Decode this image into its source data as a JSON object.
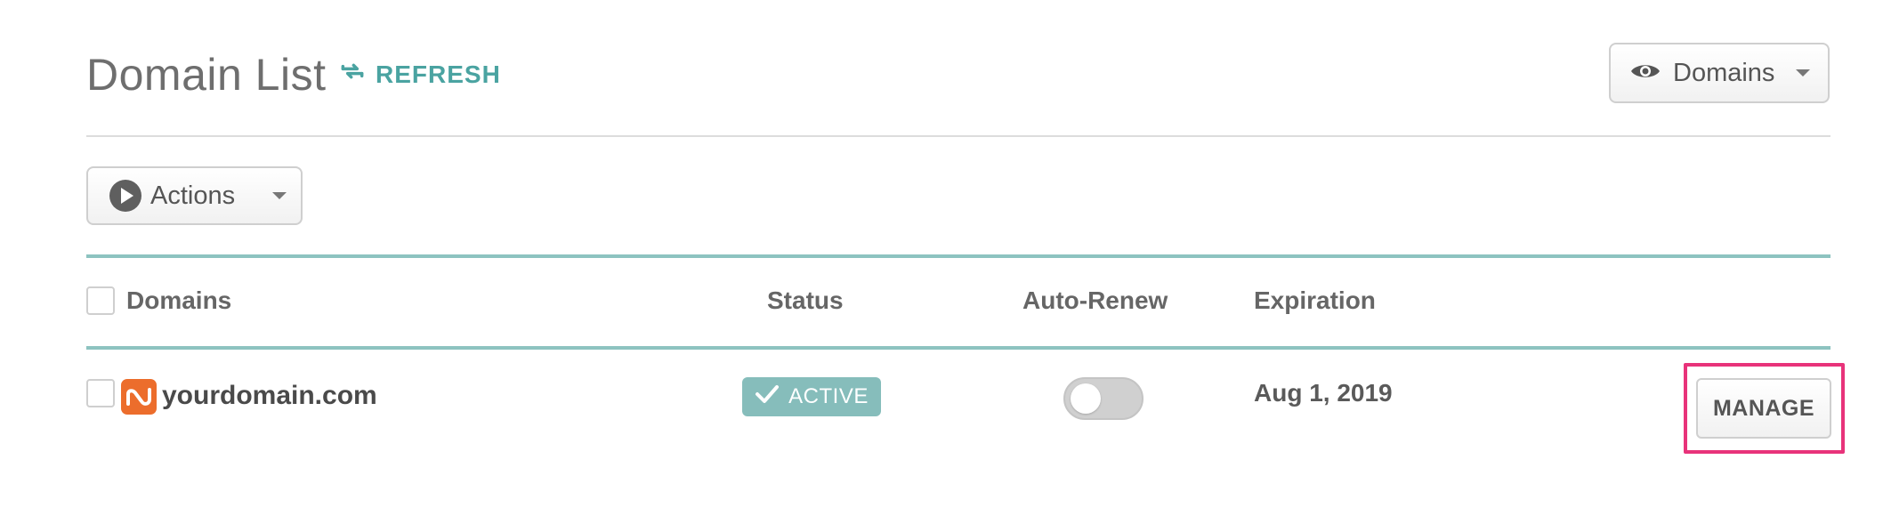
{
  "header": {
    "title": "Domain List",
    "refresh_label": "REFRESH"
  },
  "view_dropdown": {
    "label": "Domains",
    "icon": "eye-icon"
  },
  "actions_dropdown": {
    "label": "Actions",
    "icon": "play-circle-icon"
  },
  "table": {
    "columns": [
      "Domains",
      "Status",
      "Auto-Renew",
      "Expiration"
    ],
    "rows": [
      {
        "domain": "yourdomain.com",
        "status": "ACTIVE",
        "auto_renew": false,
        "expiration": "Aug 1, 2019",
        "action_label": "MANAGE"
      }
    ]
  },
  "colors": {
    "accent_teal": "#4aa3a1",
    "status_active": "#86bdbb",
    "brand_orange": "#ec6d2c",
    "highlight_pink": "#e8337a"
  }
}
